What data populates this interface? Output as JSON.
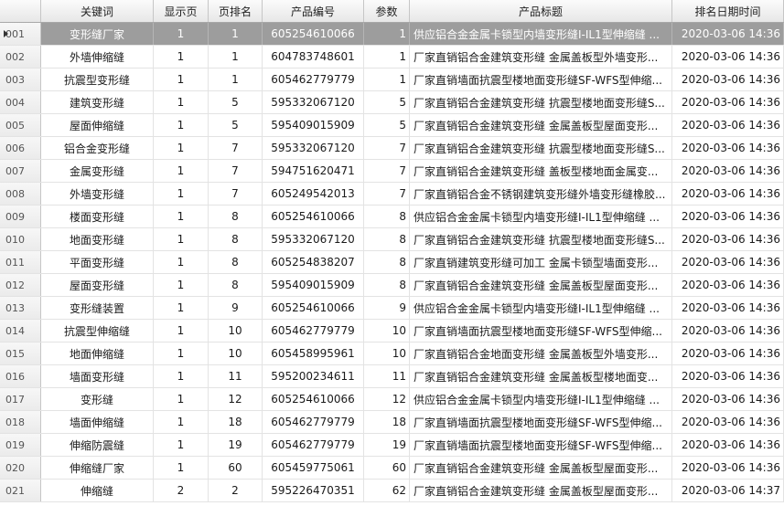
{
  "columns": [
    "",
    "关键词",
    "显示页",
    "页排名",
    "产品编号",
    "参数",
    "产品标题",
    "排名日期时间"
  ],
  "selected_row": 0,
  "rows": [
    {
      "id": "001",
      "keyword": "变形缝厂家",
      "page": "1",
      "rank": "1",
      "product_no": "605254610066",
      "param": "1",
      "title": "供应铝合金金属卡锁型内墙变形缝I-IL1型伸缩缝 ...",
      "datetime": "2020-03-06 14:36"
    },
    {
      "id": "002",
      "keyword": "外墙伸缩缝",
      "page": "1",
      "rank": "1",
      "product_no": "604783748601",
      "param": "1",
      "title": "厂家直销铝合金建筑变形缝 金属盖板型外墙变形...",
      "datetime": "2020-03-06 14:36"
    },
    {
      "id": "003",
      "keyword": "抗震型变形缝",
      "page": "1",
      "rank": "1",
      "product_no": "605462779779",
      "param": "1",
      "title": "厂家直销墙面抗震型楼地面变形缝SF-WFS型伸缩...",
      "datetime": "2020-03-06 14:36"
    },
    {
      "id": "004",
      "keyword": "建筑变形缝",
      "page": "1",
      "rank": "5",
      "product_no": "595332067120",
      "param": "5",
      "title": "厂家直销铝合金建筑变形缝 抗震型楼地面变形缝S...",
      "datetime": "2020-03-06 14:36"
    },
    {
      "id": "005",
      "keyword": "屋面伸缩缝",
      "page": "1",
      "rank": "5",
      "product_no": "595409015909",
      "param": "5",
      "title": "厂家直销铝合金建筑变形缝 金属盖板型屋面变形...",
      "datetime": "2020-03-06 14:36"
    },
    {
      "id": "006",
      "keyword": "铝合金变形缝",
      "page": "1",
      "rank": "7",
      "product_no": "595332067120",
      "param": "7",
      "title": "厂家直销铝合金建筑变形缝 抗震型楼地面变形缝S...",
      "datetime": "2020-03-06 14:36"
    },
    {
      "id": "007",
      "keyword": "金属变形缝",
      "page": "1",
      "rank": "7",
      "product_no": "594751620471",
      "param": "7",
      "title": "厂家直销铝合金建筑变形缝 盖板型楼地面金属变...",
      "datetime": "2020-03-06 14:36"
    },
    {
      "id": "008",
      "keyword": "外墙变形缝",
      "page": "1",
      "rank": "7",
      "product_no": "605249542013",
      "param": "7",
      "title": "厂家直销铝合金不锈钢建筑变形缝外墙变形缝橡胶...",
      "datetime": "2020-03-06 14:36"
    },
    {
      "id": "009",
      "keyword": "楼面变形缝",
      "page": "1",
      "rank": "8",
      "product_no": "605254610066",
      "param": "8",
      "title": "供应铝合金金属卡锁型内墙变形缝I-IL1型伸缩缝 ...",
      "datetime": "2020-03-06 14:36"
    },
    {
      "id": "010",
      "keyword": "地面变形缝",
      "page": "1",
      "rank": "8",
      "product_no": "595332067120",
      "param": "8",
      "title": "厂家直销铝合金建筑变形缝 抗震型楼地面变形缝S...",
      "datetime": "2020-03-06 14:36"
    },
    {
      "id": "011",
      "keyword": "平面变形缝",
      "page": "1",
      "rank": "8",
      "product_no": "605254838207",
      "param": "8",
      "title": "厂家直销建筑变形缝可加工 金属卡锁型墙面变形...",
      "datetime": "2020-03-06 14:36"
    },
    {
      "id": "012",
      "keyword": "屋面变形缝",
      "page": "1",
      "rank": "8",
      "product_no": "595409015909",
      "param": "8",
      "title": "厂家直销铝合金建筑变形缝 金属盖板型屋面变形...",
      "datetime": "2020-03-06 14:36"
    },
    {
      "id": "013",
      "keyword": "变形缝装置",
      "page": "1",
      "rank": "9",
      "product_no": "605254610066",
      "param": "9",
      "title": "供应铝合金金属卡锁型内墙变形缝I-IL1型伸缩缝 ...",
      "datetime": "2020-03-06 14:36"
    },
    {
      "id": "014",
      "keyword": "抗震型伸缩缝",
      "page": "1",
      "rank": "10",
      "product_no": "605462779779",
      "param": "10",
      "title": "厂家直销墙面抗震型楼地面变形缝SF-WFS型伸缩...",
      "datetime": "2020-03-06 14:36"
    },
    {
      "id": "015",
      "keyword": "地面伸缩缝",
      "page": "1",
      "rank": "10",
      "product_no": "605458995961",
      "param": "10",
      "title": "厂家直销铝合金地面变形缝 金属盖板型外墙变形...",
      "datetime": "2020-03-06 14:36"
    },
    {
      "id": "016",
      "keyword": "墙面变形缝",
      "page": "1",
      "rank": "11",
      "product_no": "595200234611",
      "param": "11",
      "title": "厂家直销铝合金建筑变形缝 金属盖板型楼地面变...",
      "datetime": "2020-03-06 14:36"
    },
    {
      "id": "017",
      "keyword": "变形缝",
      "page": "1",
      "rank": "12",
      "product_no": "605254610066",
      "param": "12",
      "title": "供应铝合金金属卡锁型内墙变形缝I-IL1型伸缩缝 ...",
      "datetime": "2020-03-06 14:36"
    },
    {
      "id": "018",
      "keyword": "墙面伸缩缝",
      "page": "1",
      "rank": "18",
      "product_no": "605462779779",
      "param": "18",
      "title": "厂家直销墙面抗震型楼地面变形缝SF-WFS型伸缩...",
      "datetime": "2020-03-06 14:36"
    },
    {
      "id": "019",
      "keyword": "伸缩防震缝",
      "page": "1",
      "rank": "19",
      "product_no": "605462779779",
      "param": "19",
      "title": "厂家直销墙面抗震型楼地面变形缝SF-WFS型伸缩...",
      "datetime": "2020-03-06 14:36"
    },
    {
      "id": "020",
      "keyword": "伸缩缝厂家",
      "page": "1",
      "rank": "60",
      "product_no": "605459775061",
      "param": "60",
      "title": "厂家直销铝合金建筑变形缝 金属盖板型屋面变形...",
      "datetime": "2020-03-06 14:36"
    },
    {
      "id": "021",
      "keyword": "伸缩缝",
      "page": "2",
      "rank": "2",
      "product_no": "595226470351",
      "param": "62",
      "title": "厂家直销铝合金建筑变形缝 金属盖板型屋面变形...",
      "datetime": "2020-03-06 14:37"
    }
  ]
}
